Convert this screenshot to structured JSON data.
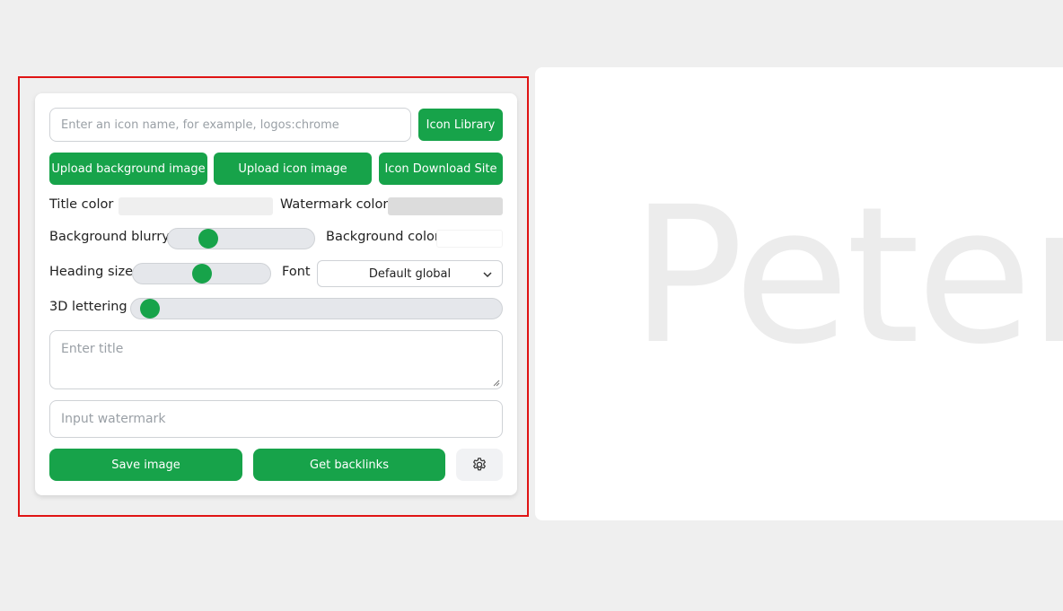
{
  "form": {
    "icon_name_placeholder": "Enter an icon name, for example, logos:chrome",
    "icon_library_label": "Icon Library",
    "upload_background_label": "Upload background image",
    "upload_icon_label": "Upload icon image",
    "icon_download_site_label": "Icon Download Site",
    "title_color_label": "Title color",
    "title_color_value": "#efefef",
    "watermark_color_label": "Watermark color",
    "watermark_color_value": "#dcdcdc",
    "background_blurry_label": "Background blurry",
    "background_blurry_level": 0.2,
    "background_color_label": "Background color",
    "background_color_value": "#ffffff",
    "heading_size_label": "Heading size",
    "heading_size_level": 0.5,
    "font_label": "Font",
    "font_selected": "Default global",
    "lettering_3d_label": "3D lettering",
    "lettering_3d_level": 0,
    "title_placeholder": "Enter title",
    "watermark_placeholder": "Input watermark",
    "save_image_label": "Save image",
    "get_backlinks_label": "Get backlinks",
    "settings_icon": "gear-icon"
  },
  "preview": {
    "text": "Peter"
  },
  "colors": {
    "accent": "#17a34a",
    "highlight_border": "#e01414",
    "page_background": "#efefef"
  }
}
